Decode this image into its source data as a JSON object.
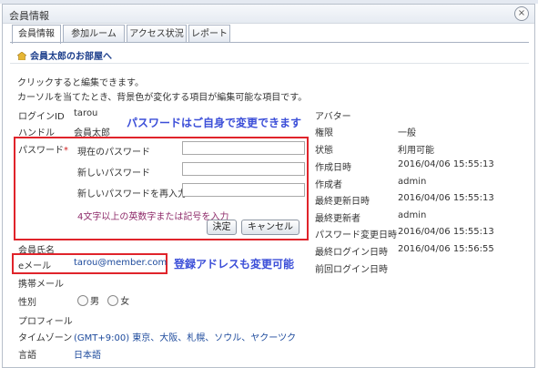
{
  "window": {
    "title": "会員情報",
    "close_icon": "×"
  },
  "tabs": [
    {
      "label": "会員情報"
    },
    {
      "label": "参加ルーム"
    },
    {
      "label": "アクセス状況"
    },
    {
      "label": "レポート"
    }
  ],
  "room_link": "会員太郎のお部屋へ",
  "instructions": {
    "line1": "クリックすると編集できます。",
    "line2": "カーソルを当てたとき、背景色が変化する項目が編集可能な項目です。"
  },
  "left": {
    "login_id_label": "ログインID",
    "login_id_value": "tarou",
    "handle_label": "ハンドル",
    "handle_value": "会員太郎",
    "password_label": "パスワード",
    "required_mark": "*",
    "current_password_label": "現在のパスワード",
    "new_password_label": "新しいパスワード",
    "confirm_password_label": "新しいパスワードを再入力",
    "password_hint": "4文字以上の英数字または記号を入力",
    "ok_button": "決定",
    "cancel_button": "キャンセル",
    "member_name_label": "会員氏名",
    "email_label": "eメール",
    "email_value": "tarou@member.com",
    "mobile_label": "携帯メール",
    "gender_label": "性別",
    "gender_male": "男",
    "gender_female": "女",
    "profile_label": "プロフィール",
    "timezone_label": "タイムゾーン",
    "timezone_value": "(GMT+9:00) 東京、大阪、札幌、ソウル、ヤクーツク",
    "language_label": "言語",
    "language_value": "日本語"
  },
  "right": {
    "avatar_label": "アバター",
    "rows": [
      {
        "label": "権限",
        "value": "一般"
      },
      {
        "label": "状態",
        "value": "利用可能"
      },
      {
        "label": "作成日時",
        "value": "2016/04/06 15:55:13"
      },
      {
        "label": "作成者",
        "value": "admin"
      },
      {
        "label": "最終更新日時",
        "value": "2016/04/06 15:55:13"
      },
      {
        "label": "最終更新者",
        "value": "admin"
      },
      {
        "label": "パスワード変更日時",
        "value": "2016/04/06 15:55:13"
      },
      {
        "label": "最終ログイン日時",
        "value": "2016/04/06 15:56:55"
      },
      {
        "label": "前回ログイン日時",
        "value": ""
      }
    ]
  },
  "callouts": {
    "password": "パスワードはご自身で変更できます",
    "email": "登録アドレスも変更可能"
  },
  "colors": {
    "annotation_red": "#e0242b",
    "annotation_blue": "#3b4ed8",
    "link": "#1d4a9c"
  }
}
